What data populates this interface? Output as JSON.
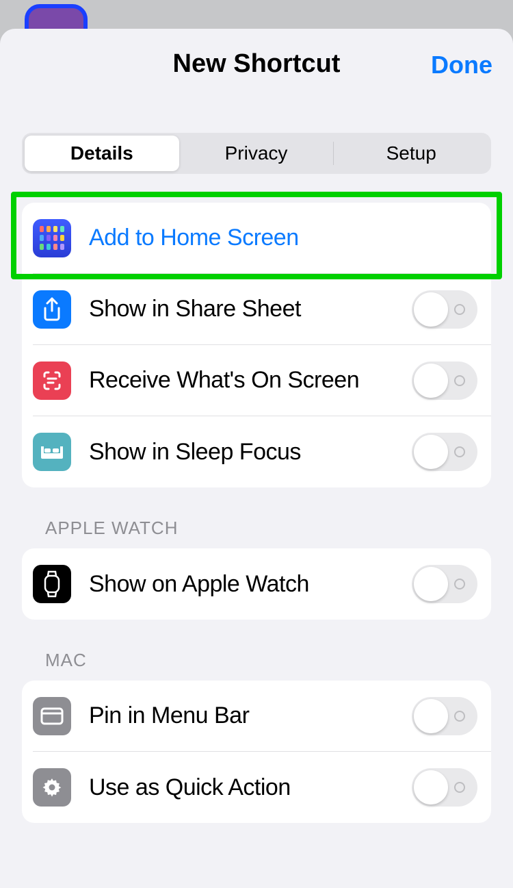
{
  "header": {
    "title": "New Shortcut",
    "done": "Done"
  },
  "tabs": {
    "details": "Details",
    "privacy": "Privacy",
    "setup": "Setup",
    "active": "details"
  },
  "rows": {
    "add_home": "Add to Home Screen",
    "share_sheet": "Show in Share Sheet",
    "receive": "Receive What's On Screen",
    "sleep_focus": "Show in Sleep Focus"
  },
  "sections": {
    "apple_watch": {
      "title": "APPLE WATCH",
      "show": "Show on Apple Watch"
    },
    "mac": {
      "title": "MAC",
      "pin": "Pin in Menu Bar",
      "quick": "Use as Quick Action"
    }
  },
  "home_grid_colors": [
    "#ff6b6b",
    "#ffa94d",
    "#ffe066",
    "#63e6be",
    "#4dabf7",
    "#845ef7",
    "#f783ac",
    "#ffd43b",
    "#69db7c",
    "#3bc9db",
    "#ff8787",
    "#b197fc"
  ]
}
